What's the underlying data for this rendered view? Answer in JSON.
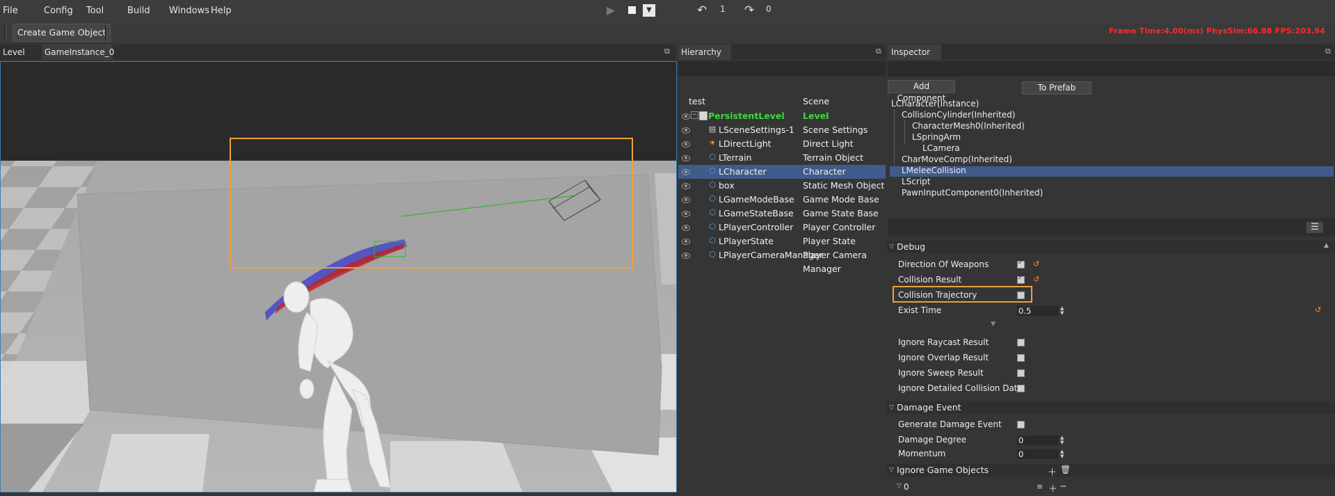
{
  "menubar": {
    "items": [
      "File",
      "Config",
      "Tool",
      "Build",
      "Windows",
      "Help"
    ],
    "undo_count": "1",
    "redo_count": "0"
  },
  "toolbar": {
    "create_button": "Create Game Object",
    "stats": "Frame Time:4.00(ms)   PhysSim:66.88   FPS:203.94"
  },
  "viewport": {
    "tabs": [
      "Level",
      "GameInstance_0"
    ]
  },
  "hierarchy": {
    "title": "Hierarchy",
    "col_name": "test",
    "col_type": "Scene",
    "root": {
      "name": "PersistentLevel",
      "type": "Level"
    },
    "items": [
      {
        "name": "LSceneSettings-1",
        "type": "Scene Settings",
        "icon": "settings-icon"
      },
      {
        "name": "LDirectLight",
        "type": "Direct Light",
        "icon": "sun-icon"
      },
      {
        "name": "LTerrain",
        "type": "Terrain Object",
        "icon": "cube-icon"
      },
      {
        "name": "LCharacter",
        "type": "Character",
        "icon": "cube-icon"
      },
      {
        "name": "box",
        "type": "Static Mesh Object",
        "icon": "cube-icon"
      },
      {
        "name": "LGameModeBase",
        "type": "Game Mode Base",
        "icon": "cube-icon"
      },
      {
        "name": "LGameStateBase",
        "type": "Game State Base",
        "icon": "cube-icon"
      },
      {
        "name": "LPlayerController",
        "type": "Player Controller",
        "icon": "cube-icon"
      },
      {
        "name": "LPlayerState",
        "type": "Player State",
        "icon": "cube-icon"
      },
      {
        "name": "LPlayerCameraManager",
        "type": "Player Camera Manager",
        "icon": "cube-icon"
      }
    ],
    "selected": "LCharacter"
  },
  "inspector": {
    "title": "Inspector",
    "add_component": "Add Component",
    "to_prefab": "To Prefab",
    "components": [
      "LCharacter(Instance)",
      "CollisionCylinder(Inherited)",
      "CharacterMesh0(Inherited)",
      "LSpringArm",
      "LCamera",
      "CharMoveComp(Inherited)",
      "LMeleeCollision",
      "LScript",
      "PawnInputComponent0(Inherited)"
    ],
    "selected_component": "LMeleeCollision",
    "debug_section": "Debug",
    "debug_props": {
      "direction_of_weapons": "Direction Of Weapons",
      "collision_result": "Collision Result",
      "collision_trajectory": "Collision Trajectory",
      "exist_time": "Exist Time",
      "exist_time_value": "0.5",
      "ignore_raycast": "Ignore Raycast Result",
      "ignore_overlap": "Ignore Overlap Result",
      "ignore_sweep": "Ignore Sweep Result",
      "ignore_detailed": "Ignore Detailed Collision Data"
    },
    "checkbox_states": {
      "direction_of_weapons": true,
      "collision_result": true,
      "collision_trajectory": false,
      "ignore_raycast": false,
      "ignore_overlap": false,
      "ignore_sweep": false,
      "ignore_detailed": false,
      "generate_damage_event": false
    },
    "damage_section": "Damage Event",
    "damage_props": {
      "generate": "Generate Damage Event",
      "degree": "Damage Degree",
      "degree_value": "0",
      "momentum": "Momentum",
      "momentum_value": "0"
    },
    "ignore_section": "Ignore Game Objects",
    "ignore_index": "0"
  },
  "colors": {
    "accent_highlight": "#ef9f3c",
    "selection": "#3f5b8a",
    "level_green": "#3bdc3b",
    "stats_red": "#ff2a2a"
  }
}
